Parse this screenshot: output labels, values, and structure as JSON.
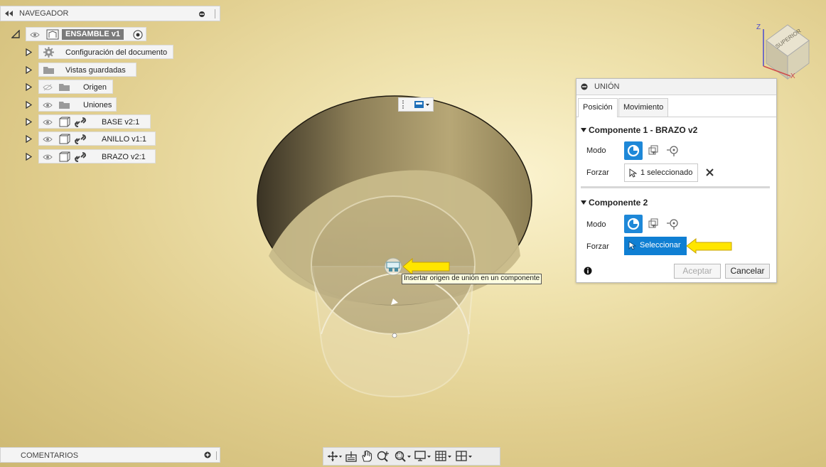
{
  "navigator": {
    "title": "NAVEGADOR",
    "root": {
      "label": "ENSAMBLE v1"
    },
    "items": [
      {
        "label": "Configuración del documento",
        "icon": "gear-icon"
      },
      {
        "label": "Vistas guardadas",
        "icon": "folder-icon"
      },
      {
        "label": "Origen",
        "icon": "folder-icon"
      },
      {
        "label": "Uniones",
        "icon": "folder-icon"
      },
      {
        "label": "BASE v2:1",
        "icon": "component-icon"
      },
      {
        "label": "ANILLO v1:1",
        "icon": "component-icon"
      },
      {
        "label": "BRAZO v2:1",
        "icon": "component-icon"
      }
    ]
  },
  "comments": {
    "title": "COMENTARIOS"
  },
  "viewcube": {
    "face": "SUPERIOR",
    "axis_z": "Z",
    "axis_x": "X"
  },
  "panel": {
    "title": "UNIÓN",
    "tabs": [
      "Posición",
      "Movimiento"
    ],
    "component1": {
      "title": "Componente 1 - BRAZO v2",
      "mode_label": "Modo",
      "snap_label": "Forzar",
      "snap_value": "1 seleccionado"
    },
    "component2": {
      "title": "Componente 2",
      "mode_label": "Modo",
      "snap_label": "Forzar",
      "snap_button": "Seleccionar"
    },
    "ok_label": "Aceptar",
    "cancel_label": "Cancelar"
  },
  "tooltip": {
    "text": "Insertar origen de unión en un componente"
  },
  "colors": {
    "accent": "#1e88d8",
    "highlight_arrow": "#ffe600",
    "viewport": "#efe2ad"
  }
}
